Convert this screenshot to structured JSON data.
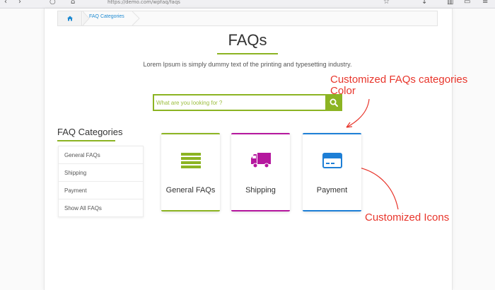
{
  "browser": {
    "url_text": "https://demo.com/wpfaq/faqs"
  },
  "breadcrumb": {
    "item": "FAQ Categories"
  },
  "header": {
    "title": "FAQs",
    "subtitle": "Lorem Ipsum is simply dummy text of the printing and typesetting industry."
  },
  "search": {
    "placeholder": "What are you looking for ?"
  },
  "annotations": {
    "top_line1": "Customized FAQs categories",
    "top_line2": "Color",
    "bottom": "Customized Icons"
  },
  "sidebar": {
    "heading": "FAQ Categories",
    "items": [
      {
        "label": "General FAQs"
      },
      {
        "label": "Shipping"
      },
      {
        "label": "Payment"
      },
      {
        "label": "Show All FAQs"
      }
    ]
  },
  "cards": [
    {
      "label": "General FAQs",
      "color": "#8cb423",
      "icon": "list-bars-icon"
    },
    {
      "label": "Shipping",
      "color": "#b5179e",
      "icon": "truck-icon"
    },
    {
      "label": "Payment",
      "color": "#1e7fd6",
      "icon": "credit-card-icon"
    }
  ],
  "colors": {
    "accent": "#8cb423",
    "annotation": "#e8352b",
    "link": "#1f8ad1"
  }
}
